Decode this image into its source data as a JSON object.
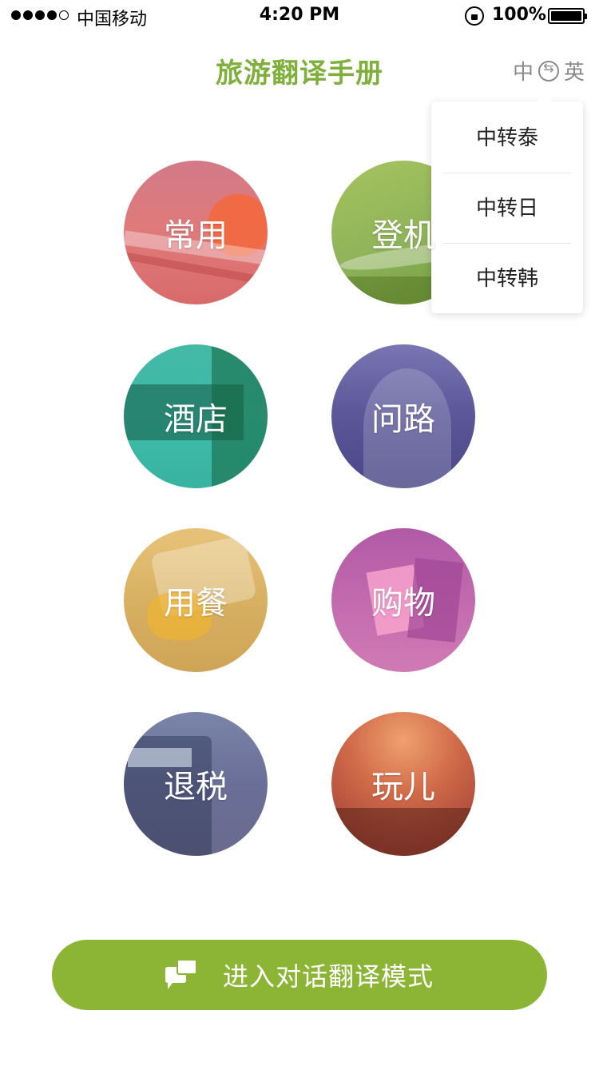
{
  "status_bar": {
    "carrier": "中国移动",
    "time": "4:20 PM",
    "battery": "100%",
    "signal_bars_filled": 4,
    "signal_bars_total": 5
  },
  "header": {
    "title": "旅游翻译手册",
    "lang_from": "中",
    "lang_to": "英"
  },
  "dropdown": {
    "items": [
      "中转泰",
      "中转日",
      "中转韩"
    ]
  },
  "categories": [
    {
      "label": "常用",
      "color": "#e07a7a"
    },
    {
      "label": "登机",
      "color": "#8fb35a"
    },
    {
      "label": "酒店",
      "color": "#3dbaa8"
    },
    {
      "label": "问路",
      "color": "#5a5698"
    },
    {
      "label": "用餐",
      "color": "#d8b061"
    },
    {
      "label": "购物",
      "color": "#c26aae"
    },
    {
      "label": "退税",
      "color": "#6a6f98"
    },
    {
      "label": "玩儿",
      "color": "#c05a48"
    }
  ],
  "cta": {
    "label": "进入对话翻译模式",
    "icon": "chat-bubbles-icon",
    "color": "#8cb536"
  },
  "colors": {
    "accent": "#7fb03b"
  }
}
